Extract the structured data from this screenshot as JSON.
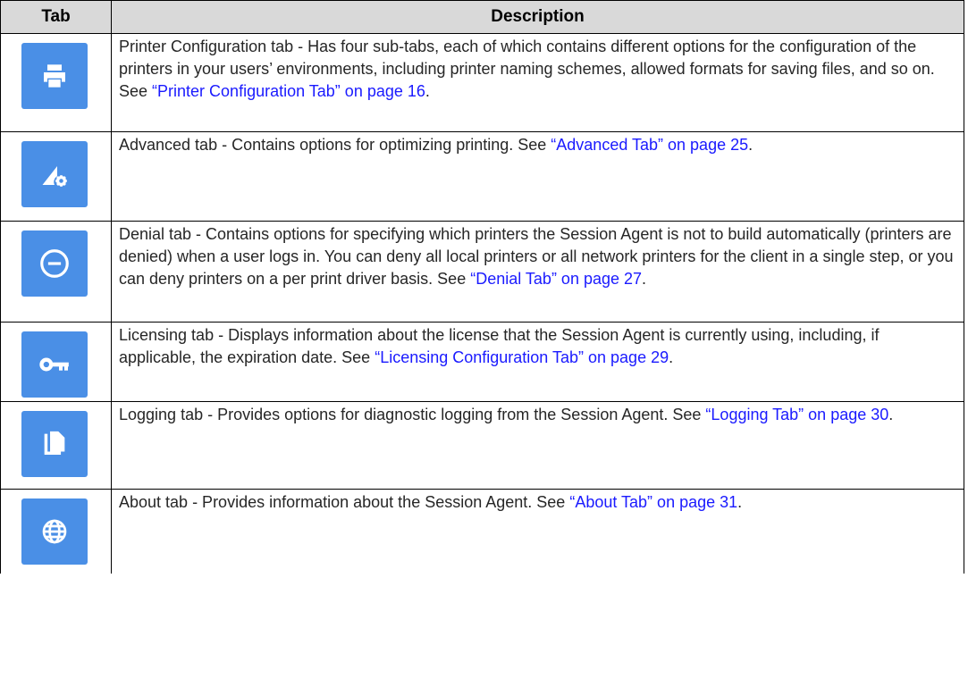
{
  "table": {
    "header": {
      "tab": "Tab",
      "description": "Description"
    },
    "rows": [
      {
        "icon": "printer-icon",
        "text": "Printer Configuration tab - Has four sub-tabs, each of which contains different options for the configuration of the printers in your users’ environments, including printer naming schemes, allowed formats for saving files, and so on. See ",
        "link": "“Printer Configuration Tab” on page 16",
        "end": "."
      },
      {
        "icon": "advanced-settings-icon",
        "text": "Advanced tab - Contains options for optimizing printing. See ",
        "link": "“Advanced Tab” on page 25",
        "end": "."
      },
      {
        "icon": "minus-circle-icon",
        "text": "Denial tab - Contains options for specifying which printers the Session Agent is not to build automatically (printers are denied) when a user logs in. You can deny all local printers or all network printers for the client in a single step, or you can deny printers on a per print driver basis. See ",
        "link": "“Denial Tab” on page 27",
        "end": "."
      },
      {
        "icon": "key-icon",
        "text": "Licensing tab - Displays information about the license that the Session Agent is currently using, including, if applicable, the expiration date. See ",
        "link": "“Licensing Configuration Tab” on page 29",
        "end": "."
      },
      {
        "icon": "copy-file-icon",
        "text": "Logging tab - Provides options for diagnostic logging from the Session Agent. See ",
        "link": "“Logging Tab” on page 30",
        "end": "."
      },
      {
        "icon": "globe-icon",
        "text": "About tab - Provides information about the Session Agent. See ",
        "link": "“About Tab” on page 31",
        "end": "."
      }
    ]
  },
  "colors": {
    "icon_bg": "#4a8fe6",
    "link": "#1a1aff",
    "header_bg": "#d9d9d9"
  }
}
